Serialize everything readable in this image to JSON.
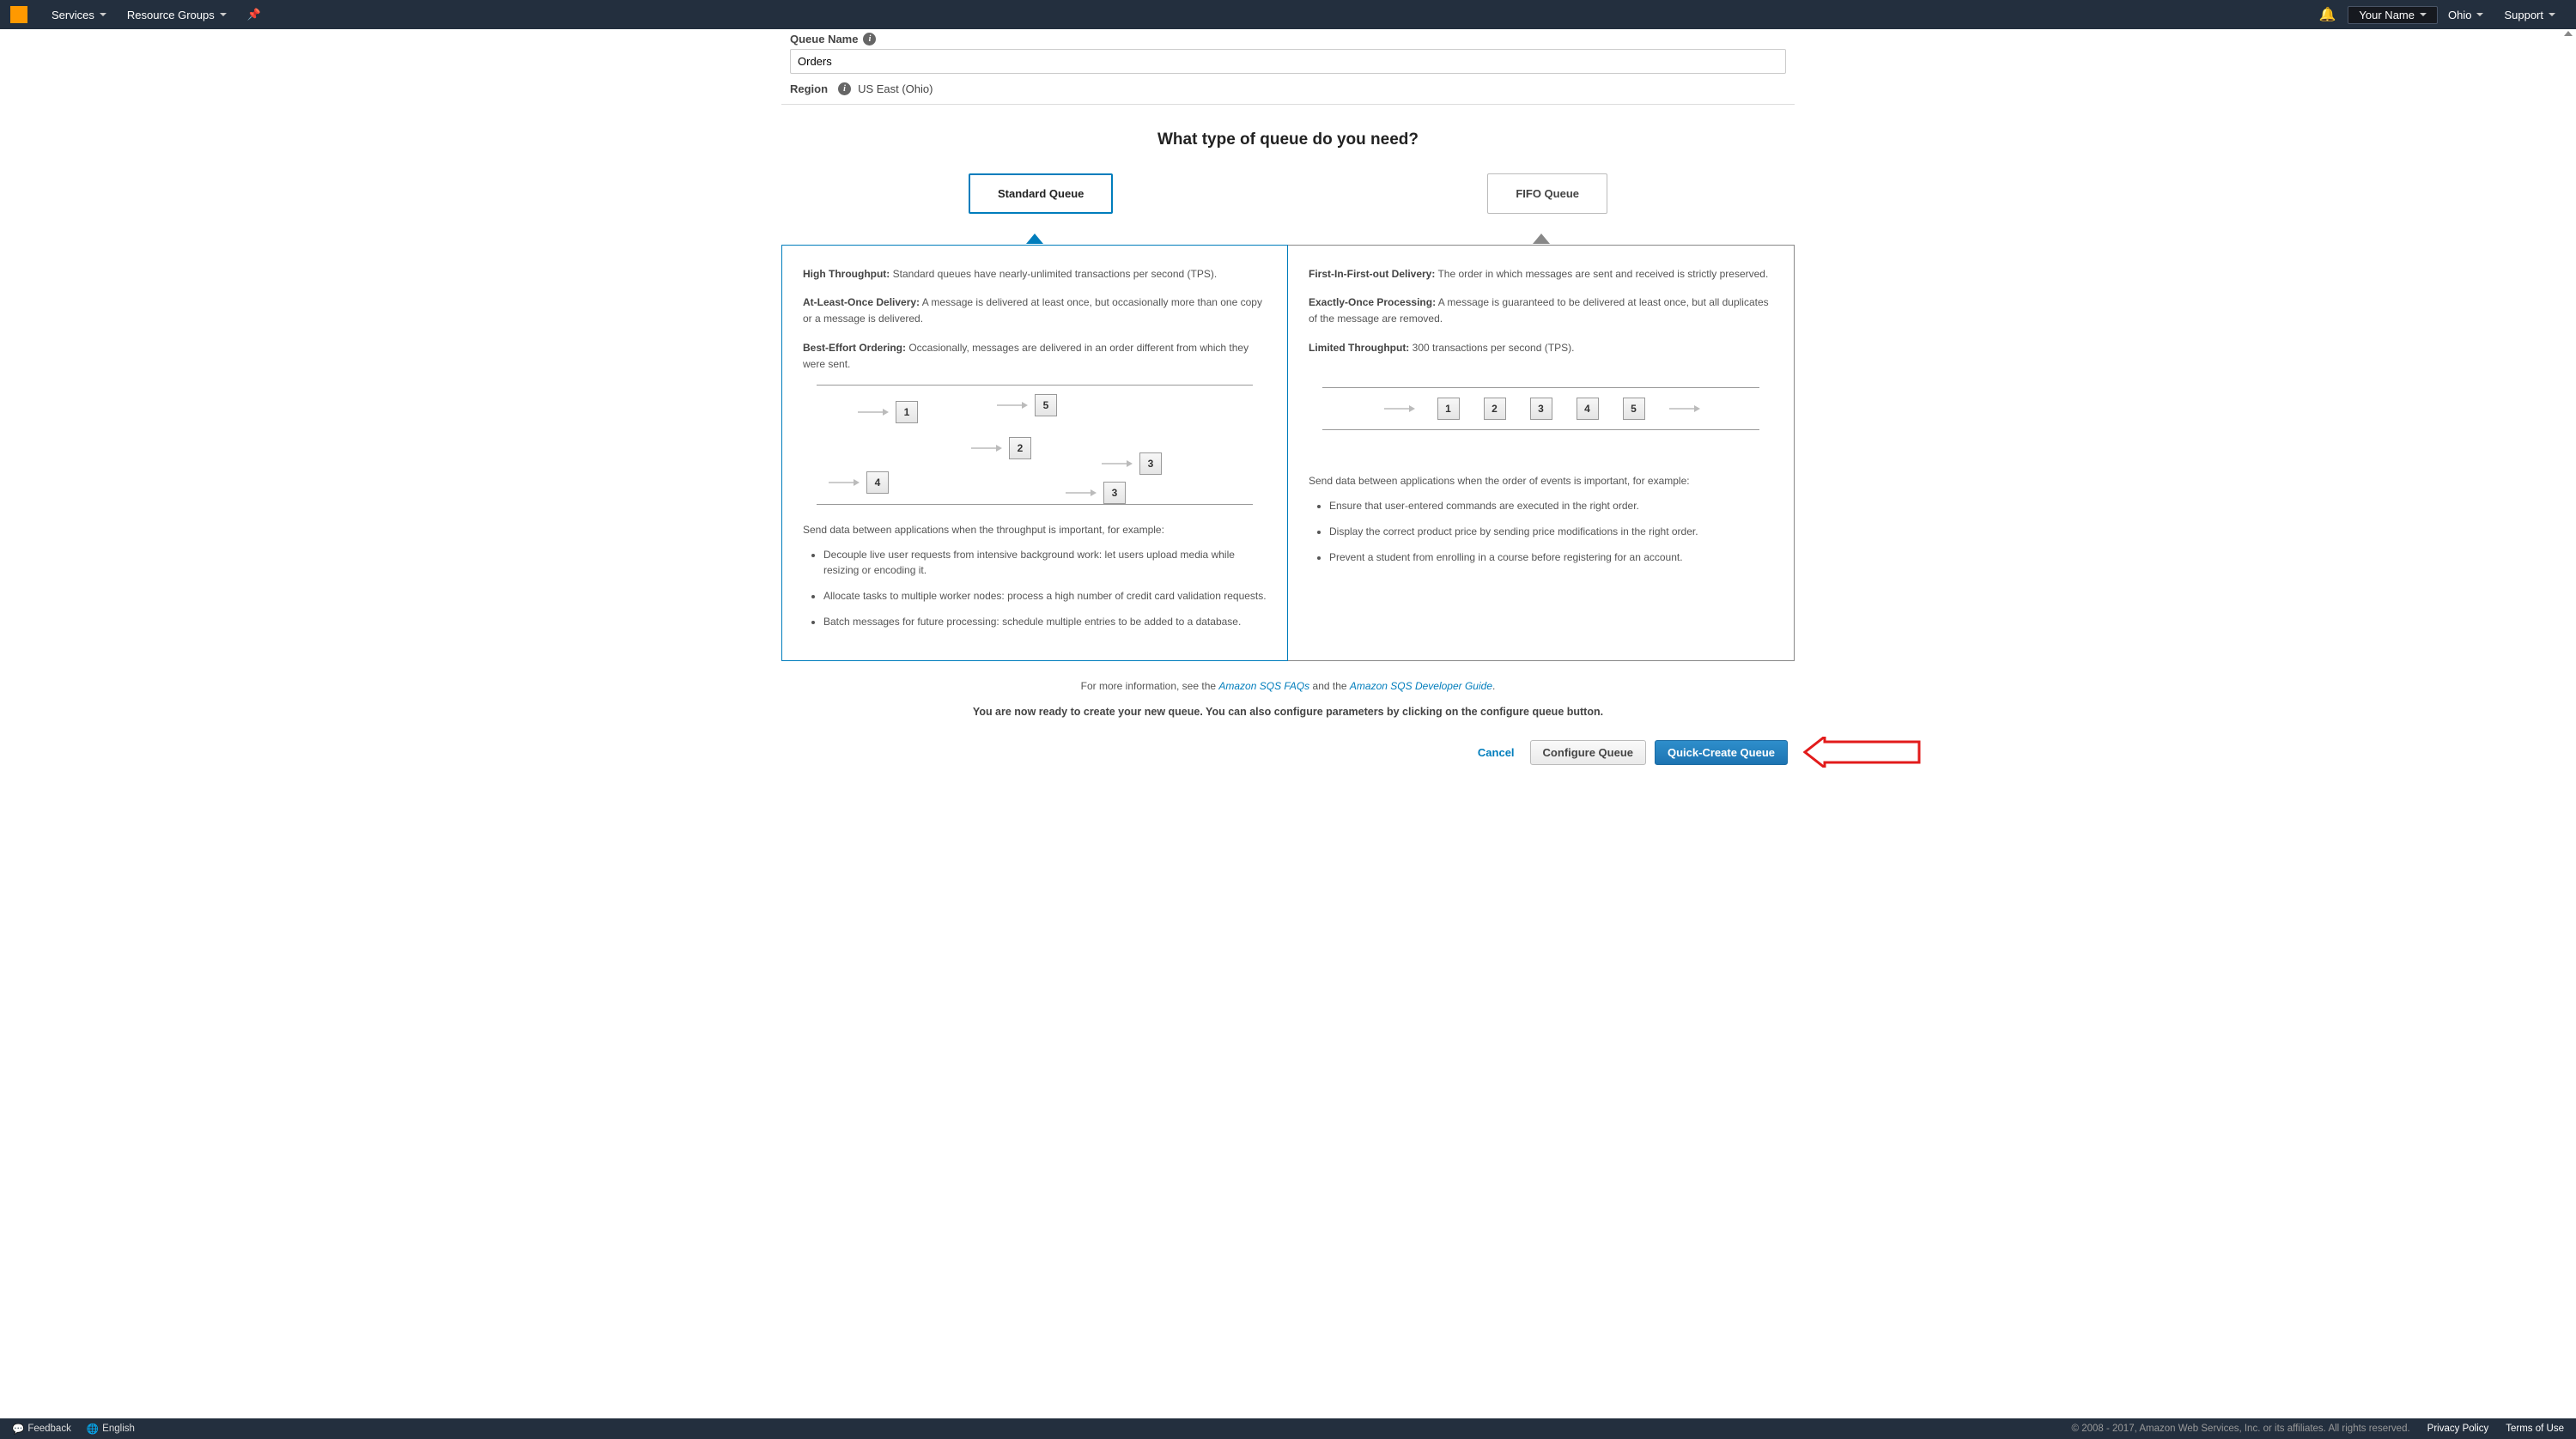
{
  "topbar": {
    "services": "Services",
    "resource_groups": "Resource Groups",
    "your_name": "Your Name",
    "region_short": "Ohio",
    "support": "Support"
  },
  "form": {
    "queue_name_label": "Queue Name",
    "queue_name_value": "Orders",
    "region_label": "Region",
    "region_value": "US East (Ohio)"
  },
  "title": "What type of queue do you need?",
  "types": {
    "standard": "Standard Queue",
    "fifo": "FIFO Queue"
  },
  "standard_panel": {
    "p1_lead": "High Throughput:",
    "p1_text": " Standard queues have nearly-unlimited transactions per second (TPS).",
    "p2_lead": "At-Least-Once Delivery:",
    "p2_text": " A message is delivered at least once, but occasionally more than one copy or a message is delivered.",
    "p3_lead": "Best-Effort Ordering:",
    "p3_text": " Occasionally, messages are delivered in an order different from which they were sent.",
    "diagram_numbers": [
      "1",
      "5",
      "2",
      "3",
      "4",
      "3"
    ],
    "use_case": "Send data between applications when the throughput is important, for example:",
    "bullets": [
      "Decouple live user requests from intensive background work: let users upload media while resizing or encoding it.",
      "Allocate tasks to multiple worker nodes: process a high number of credit card validation requests.",
      "Batch messages for future processing: schedule multiple entries to be added to a database."
    ]
  },
  "fifo_panel": {
    "p1_lead": "First-In-First-out Delivery:",
    "p1_text": " The order in which messages are sent and received is strictly preserved.",
    "p2_lead": "Exactly-Once Processing:",
    "p2_text": " A message is guaranteed to be delivered at least once, but all duplicates of the message are removed.",
    "p3_lead": "Limited Throughput:",
    "p3_text": " 300 transactions per second (TPS).",
    "diagram_numbers": [
      "1",
      "2",
      "3",
      "4",
      "5"
    ],
    "use_case": "Send data between applications when the order of events is important, for example:",
    "bullets": [
      "Ensure that user-entered commands are executed in the right order.",
      "Display the correct product price by sending price modifications in the right order.",
      "Prevent a student from enrolling in a course before registering for an account."
    ]
  },
  "footer": {
    "info_pre": "For more information, see the ",
    "link1": "Amazon SQS FAQs",
    "info_mid": " and the ",
    "link2": "Amazon SQS Developer Guide",
    "info_post": ".",
    "ready": "You are now ready to create your new queue. You can also configure parameters by clicking on the configure queue button."
  },
  "actions": {
    "cancel": "Cancel",
    "configure": "Configure Queue",
    "create": "Quick-Create Queue"
  },
  "bottombar": {
    "feedback": "Feedback",
    "language": "English",
    "copyright": "© 2008 - 2017, Amazon Web Services, Inc. or its affiliates. All rights reserved.",
    "privacy": "Privacy Policy",
    "terms": "Terms of Use"
  }
}
